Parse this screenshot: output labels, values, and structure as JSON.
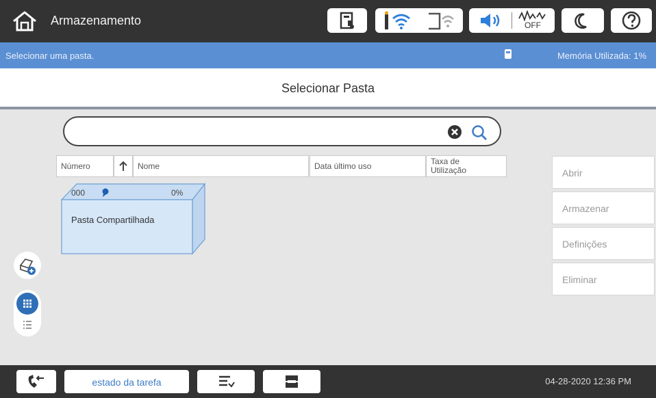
{
  "header": {
    "title": "Armazenamento",
    "icons": [
      "home-icon",
      "document-status-icon",
      "wifi-icon",
      "wifi-direct-icon",
      "volume-icon",
      "network-off-icon",
      "sleep-icon",
      "help-icon"
    ],
    "off_label": "OFF"
  },
  "info_bar": {
    "instruction": "Selecionar uma pasta.",
    "memory": "Memória Utilizada: 1%"
  },
  "screen": {
    "title": "Selecionar Pasta"
  },
  "search": {
    "value": "",
    "placeholder": ""
  },
  "columns": {
    "number": "Número",
    "name": "Nome",
    "last_used": "Data último uso",
    "usage_rate": "Taxa de Utilização"
  },
  "sort": {
    "column": "Número",
    "direction": "ascending"
  },
  "folders": [
    {
      "number": "000",
      "usage": "0%",
      "name": "Pasta Compartilhada"
    }
  ],
  "actions": {
    "open": "Abrir",
    "store": "Armazenar",
    "settings": "Definições",
    "delete": "Eliminar"
  },
  "view_mode": {
    "selected": "grid",
    "options": [
      "grid",
      "list"
    ]
  },
  "footer": {
    "task_status": "estado da tarefa",
    "datetime": "04-28-2020 12:36 PM"
  },
  "colors": {
    "accent": "#5b8fd3",
    "bar": "#333333",
    "folder_fill": "#d6e7f8"
  }
}
